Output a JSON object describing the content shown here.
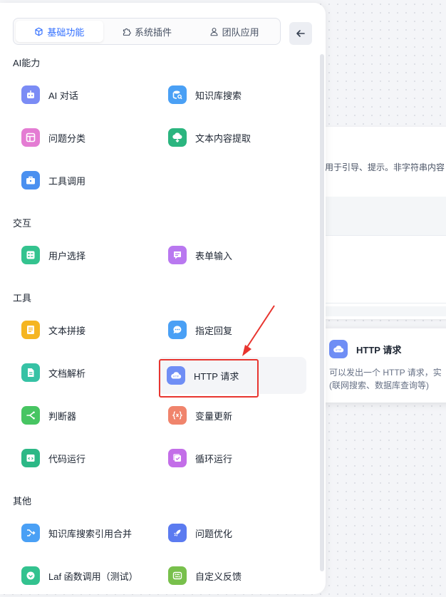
{
  "tabs": [
    {
      "label": "基础功能",
      "icon": "cube-icon",
      "active": true
    },
    {
      "label": "系统插件",
      "icon": "puzzle-icon",
      "active": false
    },
    {
      "label": "团队应用",
      "icon": "user-icon",
      "active": false
    }
  ],
  "sections": {
    "ai": "AI能力",
    "interaction": "交互",
    "tools": "工具",
    "other": "其他"
  },
  "items": {
    "ai_chat": "AI 对话",
    "kb_search": "知识库搜索",
    "question_classify": "问题分类",
    "text_extract": "文本内容提取",
    "tool_call": "工具调用",
    "user_select": "用户选择",
    "form_input": "表单输入",
    "text_concat": "文本拼接",
    "assigned_reply": "指定回复",
    "doc_parse": "文档解析",
    "http_request": "HTTP 请求",
    "judger": "判断器",
    "var_update": "变量更新",
    "code_run": "代码运行",
    "loop_run": "循环运行",
    "kb_merge": "知识库搜索引用合并",
    "question_optimize": "问题优化",
    "laf_call": "Laf 函数调用（测试）",
    "custom_feedback": "自定义反馈"
  },
  "tooltip": {
    "title": "HTTP 请求",
    "desc_line1": "可以发出一个 HTTP 请求，实",
    "desc_line2": "(联网搜索、数据库查询等)"
  },
  "background_node": {
    "text": "用于引导、提示。非字符串内容"
  },
  "colors": {
    "accent": "#3370ff",
    "highlight": "#e8352f"
  }
}
